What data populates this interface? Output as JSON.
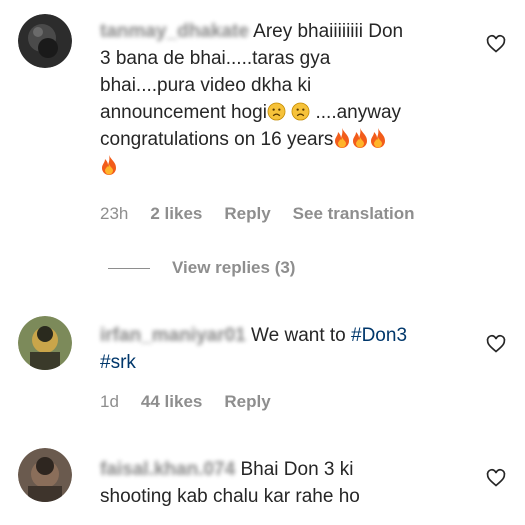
{
  "comments": [
    {
      "username": "tanmay_dhakate",
      "text_lines": [
        "Arey bhaiiiiiiii Don",
        "3 bana de bhai.....taras gya",
        "bhai....pura video dkha ki",
        "announcement hogi",
        " ....anyway",
        "congratulations on 16 years"
      ],
      "time": "23h",
      "likes": "2 likes",
      "reply": "Reply",
      "translate": "See translation",
      "view_replies": "View replies (3)"
    },
    {
      "username": "irfan_maniyar01",
      "text_prefix": "We want to ",
      "hashtag1": "#Don3",
      "hashtag2": "#srk",
      "time": "1d",
      "likes": "44 likes",
      "reply": "Reply"
    },
    {
      "username": "faisal.khan.074",
      "text_lines": [
        "Bhai Don 3 ki",
        "shooting kab chalu kar rahe ho"
      ]
    }
  ],
  "icons": {
    "heart": "heart-outline-icon",
    "sad": "sad-face-emoji",
    "fire": "fire-emoji"
  },
  "colors": {
    "text": "#262626",
    "meta": "#8e8e8e",
    "hashtag": "#00376b"
  }
}
